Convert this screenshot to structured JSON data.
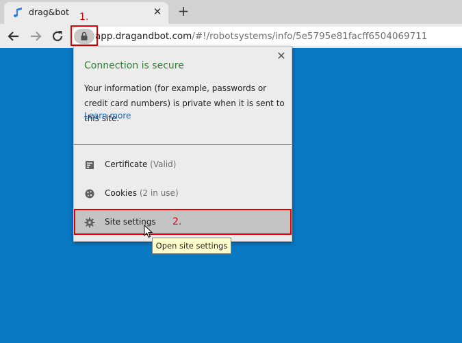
{
  "tab": {
    "title": "drag&bot",
    "close_glyph": "✕",
    "favicon": "music-note-icon"
  },
  "new_tab_glyph": "+",
  "omnibox": {
    "host": "app.dragandbot.com",
    "path": "/#!/robotsystems/info/5e5795e81facff6504069711"
  },
  "annotations": {
    "step1": "1.",
    "step2": "2."
  },
  "popup": {
    "close_glyph": "✕",
    "title": "Connection is secure",
    "body": "Your information (for example, passwords or credit card numbers) is private when it is sent to this site.",
    "learn_more": "Learn more",
    "items": [
      {
        "label": "Certificate",
        "sub": "(Valid)",
        "icon": "certificate-icon"
      },
      {
        "label": "Cookies",
        "sub": "(2 in use)",
        "icon": "cookie-icon"
      },
      {
        "label": "Site settings",
        "sub": "",
        "icon": "gear-icon"
      }
    ]
  },
  "tooltip": "Open site settings",
  "colors": {
    "page_bg": "#0a79c4",
    "secure_green": "#2e7d32",
    "annotation_red": "#e00000",
    "link_blue": "#1a5ea8"
  }
}
